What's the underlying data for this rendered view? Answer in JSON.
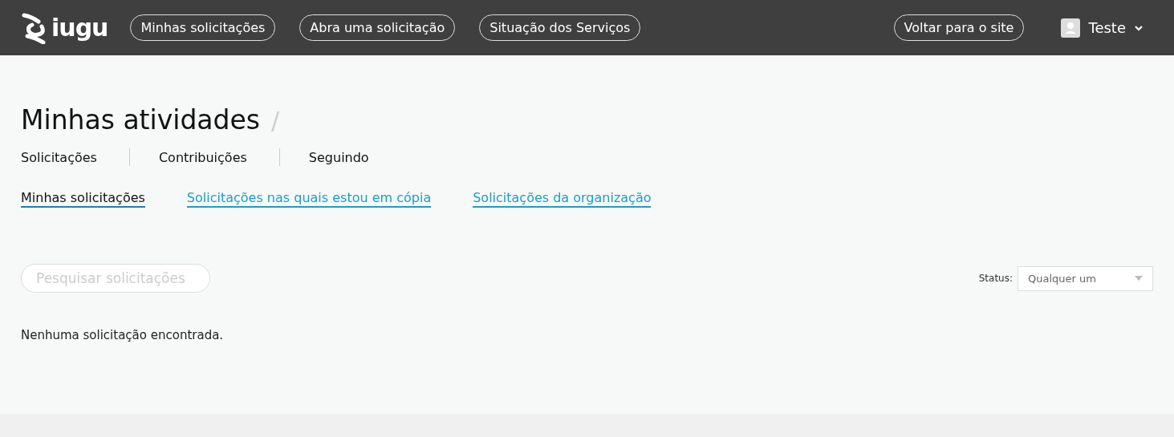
{
  "header": {
    "logo": "iugu",
    "nav": [
      "Minhas solicitações",
      "Abra uma solicitação",
      "Situação dos Serviços"
    ],
    "back_link": "Voltar para o site",
    "user": "Teste"
  },
  "page": {
    "title": "Minhas atividades",
    "separator": "/",
    "tabs": [
      "Solicitações",
      "Contribuições",
      "Seguindo"
    ],
    "subtabs": [
      {
        "label": "Minhas solicitações",
        "selected": true
      },
      {
        "label": "Solicitações nas quais estou em cópia",
        "selected": false
      },
      {
        "label": "Solicitações da organização",
        "selected": false
      }
    ],
    "search": {
      "placeholder": "Pesquisar solicitações"
    },
    "status_filter": {
      "label": "Status:",
      "value": "Qualquer um"
    },
    "empty_message": "Nenhuma solicitação encontrada."
  }
}
